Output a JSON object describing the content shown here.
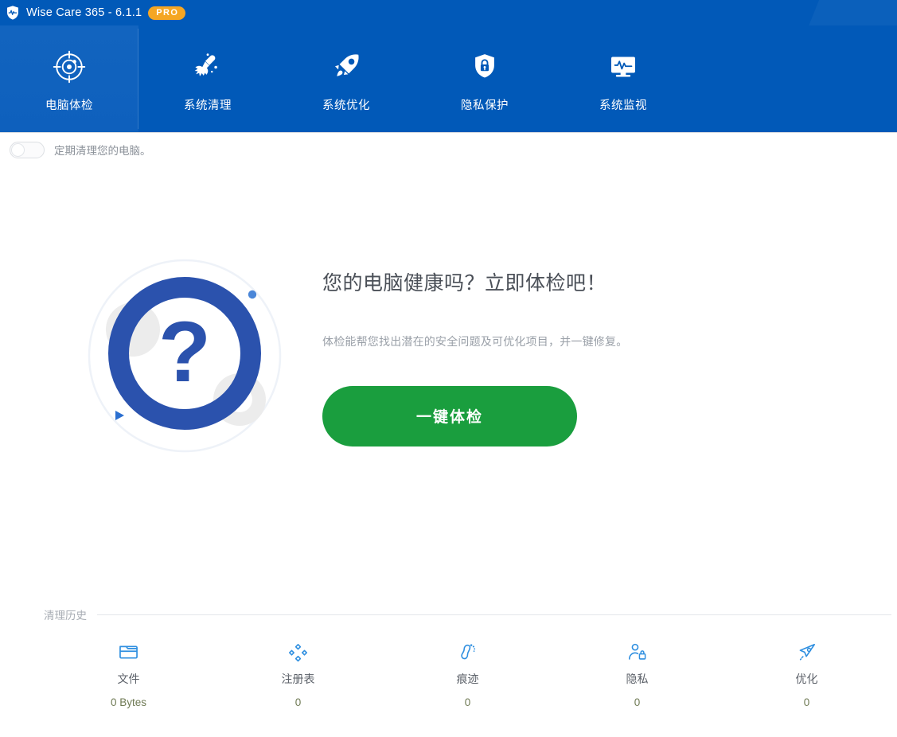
{
  "titlebar": {
    "logo_icon": "shield-pulse-icon",
    "title": "Wise Care 365 - 6.1.1",
    "badge": "PRO",
    "badge_color": "#f5a623",
    "bg_color": "#0159b8"
  },
  "nav": {
    "active_index": 0,
    "tabs": [
      {
        "label": "电脑体检",
        "icon": "target-scan-icon"
      },
      {
        "label": "系统清理",
        "icon": "broom-icon"
      },
      {
        "label": "系统优化",
        "icon": "rocket-icon"
      },
      {
        "label": "隐私保护",
        "icon": "shield-lock-icon"
      },
      {
        "label": "系统监视",
        "icon": "monitor-pulse-icon"
      }
    ]
  },
  "toggle": {
    "label": "定期清理您的电脑。",
    "state": "off",
    "icon": "toggle-switch-icon"
  },
  "hero": {
    "art_icon": "question-mark-circle-icon",
    "title": "您的电脑健康吗？立即体检吧！",
    "subtitle": "体检能帮您找出潜在的安全问题及可优化项目，并一键修复。",
    "button_label": "一键体检",
    "button_color": "#1a9e3e",
    "ring_color": "#2b52ad"
  },
  "history": {
    "section_title": "清理历史",
    "stats": [
      {
        "label": "文件",
        "value": "0 Bytes",
        "icon": "folder-icon"
      },
      {
        "label": "注册表",
        "value": "0",
        "icon": "registry-diamonds-icon"
      },
      {
        "label": "痕迹",
        "value": "0",
        "icon": "footprint-icon"
      },
      {
        "label": "隐私",
        "value": "0",
        "icon": "person-lock-icon"
      },
      {
        "label": "优化",
        "value": "0",
        "icon": "rocket-outline-icon"
      }
    ]
  }
}
